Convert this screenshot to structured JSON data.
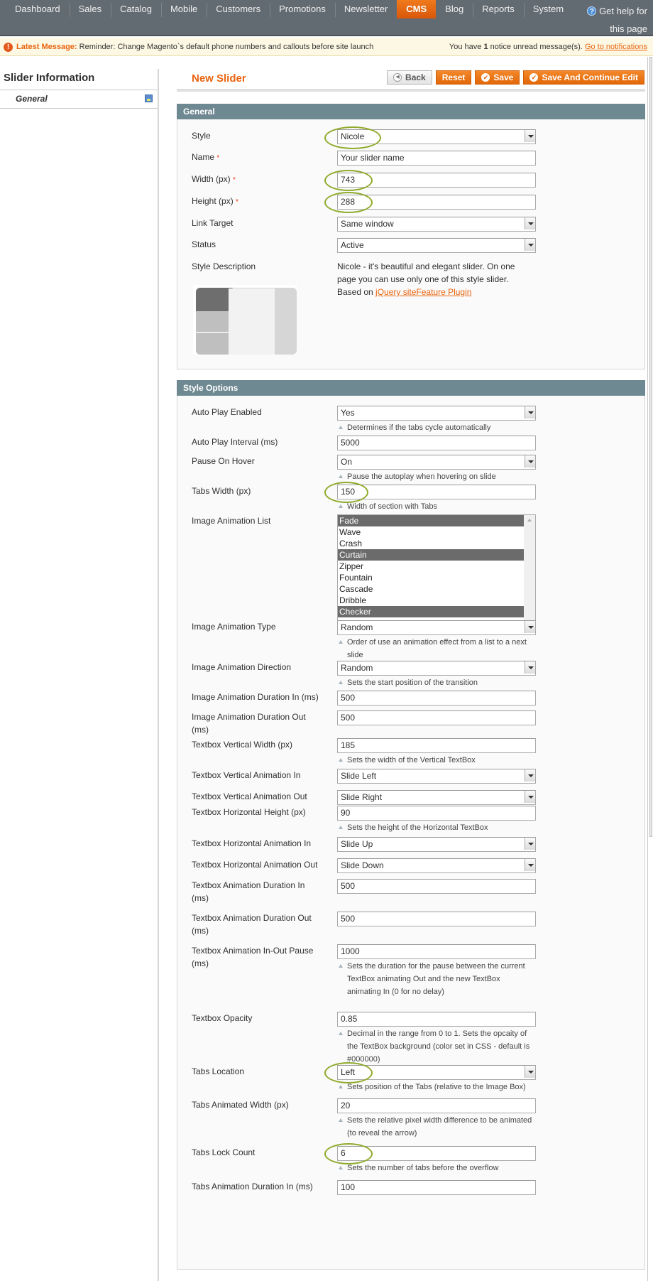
{
  "nav": {
    "items": [
      "Dashboard",
      "Sales",
      "Catalog",
      "Mobile",
      "Customers",
      "Promotions",
      "Newsletter",
      "CMS",
      "Blog",
      "Reports",
      "System"
    ],
    "active": "CMS",
    "help_line1": "Get help for",
    "help_line2": "this page"
  },
  "notice": {
    "label": "Latest Message:",
    "message": "Reminder: Change Magento`s default phone numbers and callouts before site launch",
    "unread_prefix": "You have ",
    "unread_count": "1",
    "unread_suffix": " notice unread message(s). ",
    "link": "Go to notifications"
  },
  "sidebar": {
    "title": "Slider Information",
    "tabs": [
      {
        "label": "General"
      }
    ]
  },
  "header": {
    "title": "New Slider",
    "buttons": {
      "back": "Back",
      "reset": "Reset",
      "save": "Save",
      "save_continue": "Save And Continue Edit"
    }
  },
  "general": {
    "title": "General",
    "style": {
      "label": "Style",
      "value": "Nicole"
    },
    "name": {
      "label": "Name",
      "value": "Your slider name"
    },
    "width": {
      "label": "Width (px)",
      "value": "743"
    },
    "height": {
      "label": "Height (px)",
      "value": "288"
    },
    "link_target": {
      "label": "Link Target",
      "value": "Same window"
    },
    "status": {
      "label": "Status",
      "value": "Active"
    },
    "style_description": {
      "label": "Style Description",
      "text": "Nicole - it's beautiful and elegant slider. On one page you can use only one of this style slider. Based on ",
      "link": "jQuery siteFeature Plugin"
    },
    "required_mark": "*"
  },
  "style_options": {
    "title": "Style Options",
    "auto_play_enabled": {
      "label": "Auto Play Enabled",
      "value": "Yes",
      "note": "Determines if the tabs cycle automatically"
    },
    "auto_play_interval": {
      "label": "Auto Play Interval (ms)",
      "value": "5000"
    },
    "pause_on_hover": {
      "label": "Pause On Hover",
      "value": "On",
      "note": "Pause the autoplay when hovering on slide"
    },
    "tabs_width": {
      "label": "Tabs Width (px)",
      "value": "150",
      "note": "Width of section with Tabs"
    },
    "image_animation_list": {
      "label": "Image Animation List",
      "options": [
        {
          "label": "Fade",
          "selected": true
        },
        {
          "label": "Wave",
          "selected": false
        },
        {
          "label": "Crash",
          "selected": false
        },
        {
          "label": "Curtain",
          "selected": true
        },
        {
          "label": "Zipper",
          "selected": false
        },
        {
          "label": "Fountain",
          "selected": false
        },
        {
          "label": "Cascade",
          "selected": false
        },
        {
          "label": "Dribble",
          "selected": false
        },
        {
          "label": "Checker",
          "selected": true
        }
      ]
    },
    "image_animation_type": {
      "label": "Image Animation Type",
      "value": "Random",
      "note": "Order of use an animation effect from a list to a next slide"
    },
    "image_animation_direction": {
      "label": "Image Animation Direction",
      "value": "Random",
      "note": "Sets the start position of the transition"
    },
    "image_animation_duration_in": {
      "label": "Image Animation Duration In (ms)",
      "value": "500"
    },
    "image_animation_duration_out": {
      "label": "Image Animation Duration Out (ms)",
      "value": "500"
    },
    "textbox_vertical_width": {
      "label": "Textbox Vertical Width (px)",
      "value": "185",
      "note": "Sets the width of the Vertical TextBox"
    },
    "textbox_vertical_animation_in": {
      "label": "Textbox Vertical Animation In",
      "value": "Slide Left"
    },
    "textbox_vertical_animation_out": {
      "label": "Textbox Vertical Animation Out",
      "value": "Slide Right"
    },
    "textbox_horizontal_height": {
      "label": "Textbox Horizontal Height (px)",
      "value": "90",
      "note": "Sets the height of the Horizontal TextBox"
    },
    "textbox_horizontal_animation_in": {
      "label": "Textbox Horizontal Animation In",
      "value": "Slide Up"
    },
    "textbox_horizontal_animation_out": {
      "label": "Textbox Horizontal Animation Out",
      "value": "Slide Down"
    },
    "textbox_animation_duration_in": {
      "label": "Textbox Animation Duration In (ms)",
      "value": "500"
    },
    "textbox_animation_duration_out": {
      "label": "Textbox Animation Duration Out (ms)",
      "value": "500"
    },
    "textbox_animation_pause": {
      "label": "Textbox Animation In-Out Pause (ms)",
      "value": "1000",
      "note": "Sets the duration for the pause between the current TextBox animating Out and the new TextBox animating In (0 for no delay)"
    },
    "textbox_opacity": {
      "label": "Textbox Opacity",
      "value": "0.85",
      "note": "Decimal in the range from 0 to 1. Sets the opcaity of the TextBox background (color set in CSS - default is #000000)"
    },
    "tabs_location": {
      "label": "Tabs Location",
      "value": "Left",
      "note": "Sets position of the Tabs (relative to the Image Box)"
    },
    "tabs_animated_width": {
      "label": "Tabs Animated Width (px)",
      "value": "20",
      "note": "Sets the relative pixel width difference to be animated (to reveal the arrow)"
    },
    "tabs_lock_count": {
      "label": "Tabs Lock Count",
      "value": "6",
      "note": "Sets the number of tabs before the overflow"
    },
    "tabs_animation_duration_in": {
      "label": "Tabs Animation Duration In (ms)",
      "value": "100"
    }
  },
  "colors": {
    "accent": "#e9640f",
    "nav_bg": "#636b72",
    "section_header": "#6f8992",
    "highlight_circle": "#8faa2b"
  }
}
